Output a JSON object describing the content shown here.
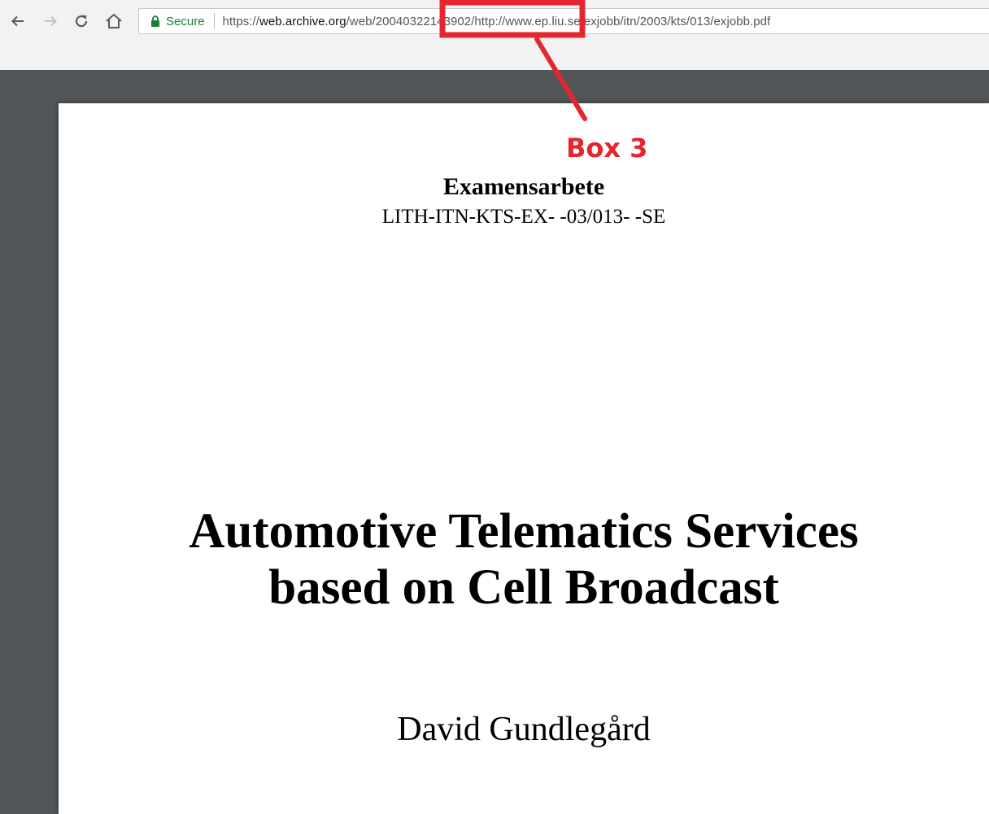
{
  "browser": {
    "nav": {
      "back_icon": "back-arrow-icon",
      "forward_icon": "forward-arrow-icon",
      "reload_icon": "reload-icon",
      "home_icon": "home-icon"
    },
    "address_bar": {
      "lock_icon": "lock-icon",
      "secure_label": "Secure",
      "url_scheme": "https://",
      "url_host": "web.archive.org",
      "url_rest": "/web/20040322143902/http://www.ep.liu.se/exjobb/itn/2003/kts/013/exjobb.pdf"
    }
  },
  "document": {
    "exam_title": "Examensarbete",
    "exam_code": "LITH-ITN-KTS-EX- -03/013- -SE",
    "title_line1": "Automotive Telematics Services",
    "title_line2": "based on Cell Broadcast",
    "author": "David Gundlegård"
  },
  "annotation": {
    "label": "Box 3",
    "color": "#e4262e"
  }
}
